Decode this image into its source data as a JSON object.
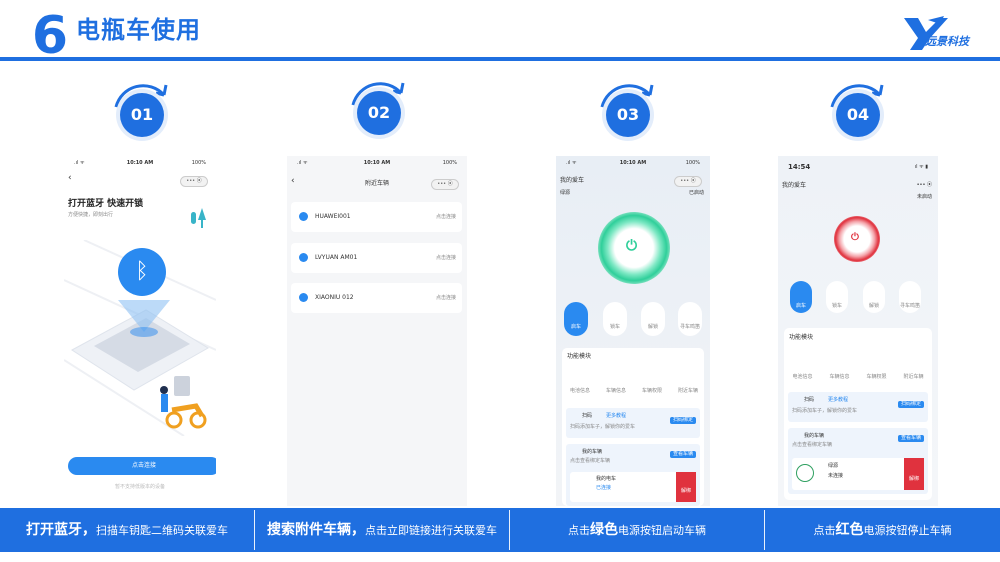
{
  "header": {
    "number": "6",
    "title": "电瓶车使用",
    "logo_text": "远景科技"
  },
  "steps": [
    "01",
    "02",
    "03",
    "04"
  ],
  "phone1": {
    "time": "10:10 AM",
    "battery": "100%",
    "title": "打开蓝牙 快速开锁",
    "subtitle": "方便快捷，即刻出行",
    "button": "点击连接",
    "footer": "暂不支持低版本的设备"
  },
  "phone2": {
    "time": "10:10 AM",
    "battery": "100%",
    "title": "附近车辆",
    "devices": [
      {
        "name": "HUAWEI001",
        "status": "点击连接"
      },
      {
        "name": "LVYUAN AM01",
        "status": "点击连接"
      },
      {
        "name": "XIAONIU 012",
        "status": "点击连接"
      }
    ]
  },
  "phone3": {
    "time": "10:10 AM",
    "battery": "100%",
    "title": "我的爱车",
    "brand": "绿源",
    "status": "已启动",
    "actions": [
      "启车",
      "锁车",
      "解锁",
      "寻车鸣笛"
    ],
    "section_title": "功能模块",
    "functions": [
      "电池信息",
      "车辆信息",
      "车辆权限",
      "附近车辆"
    ],
    "card1_title": "扫码",
    "card1_link": "更多教程",
    "card1_desc": "扫码添加车子，解锁你的爱车",
    "card1_btn": "扫码绑定",
    "card2_title": "我的车辆",
    "card2_desc": "点击查看绑定车辆",
    "card2_btn": "查看车辆",
    "car_name": "我的电车",
    "car_tag": "已连接",
    "unbind": "解绑"
  },
  "phone4": {
    "time": "14:54",
    "title": "我的爱车",
    "status": "未启动",
    "actions": [
      "启车",
      "锁车",
      "解锁",
      "寻车鸣笛"
    ],
    "section_title": "功能模块",
    "functions": [
      "电池信息",
      "车辆信息",
      "车辆权限",
      "附近车辆"
    ],
    "card1_title": "扫码",
    "card1_link": "更多教程",
    "card1_desc": "扫码添加车子，解锁你的爱车",
    "card1_btn": "扫码绑定",
    "card2_title": "我的车辆",
    "card2_desc": "点击查看绑定车辆",
    "card2_btn": "查看车辆",
    "car_name": "绿源",
    "car_tag": "未连接",
    "unbind": "解绑"
  },
  "captions": [
    {
      "bold": "打开蓝牙，",
      "rest": "扫描车钥匙二维码关联爱车"
    },
    {
      "bold": "搜索附件车辆，",
      "rest": "点击立即链接进行关联爱车"
    },
    {
      "pre": "点击",
      "bold": "绿色",
      "rest": "电源按钮启动车辆"
    },
    {
      "pre": "点击",
      "bold": "红色",
      "rest": "电源按钮停止车辆"
    }
  ],
  "colors": {
    "brand": "#1f6fe0",
    "green": "#2fcf9a",
    "red": "#e0323e"
  }
}
